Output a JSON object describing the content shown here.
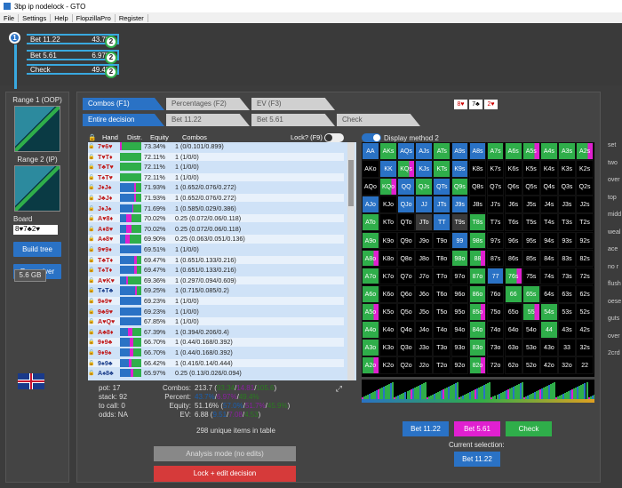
{
  "window": {
    "title": "3bp ip nodelock - GTO"
  },
  "menu": [
    "File",
    "Settings",
    "Help",
    "FlopzillaPro",
    "Register"
  ],
  "tree": {
    "root_label": "1",
    "child_label": "2",
    "nodes": [
      {
        "label": "Bet 11.22",
        "pct": "43.7%"
      },
      {
        "label": "Bet 5.61",
        "pct": "6.97%"
      },
      {
        "label": "Check",
        "pct": "49.4%"
      }
    ]
  },
  "left": {
    "range1": "Range 1 (OOP)",
    "range2": "Range 2 (IP)",
    "board_label": "Board",
    "board_value": "8♥7♣2♥",
    "build_tree": "Build tree",
    "run_solver": "Run solver",
    "memory": "5.6 GB"
  },
  "tabs_top": [
    "Combos (F1)",
    "Percentages (F2)",
    "EV (F3)"
  ],
  "tabs_second": [
    "Entire decision",
    "Bet 11.22",
    "Bet 5.61",
    "Check"
  ],
  "board_cards": [
    "8♥",
    "7♣",
    "2♥"
  ],
  "table": {
    "headers": [
      "Hand",
      "Distr.",
      "Equity",
      "Combos"
    ],
    "lock_label": "Lock? (F9)",
    "rows": [
      {
        "hand": "7♥6♥",
        "equity": "73.34%",
        "combos": "1 (0/0.101/0.899)",
        "g": 0.9,
        "p": 0.1
      },
      {
        "hand": "T♥T♦",
        "equity": "72.11%",
        "combos": "1 (1/0/0)",
        "g": 1.0,
        "p": 0
      },
      {
        "hand": "T♣T♥",
        "equity": "72.11%",
        "combos": "1 (1/0/0)",
        "g": 1.0,
        "p": 0
      },
      {
        "hand": "T♠T♥",
        "equity": "72.11%",
        "combos": "1 (1/0/0)",
        "g": 1.0,
        "p": 0
      },
      {
        "hand": "J♦J♠",
        "equity": "71.93%",
        "combos": "1 (0.652/0.076/0.272)",
        "g": 0.27,
        "p": 0.08
      },
      {
        "hand": "J♣J♦",
        "equity": "71.93%",
        "combos": "1 (0.652/0.076/0.272)",
        "g": 0.27,
        "p": 0.08
      },
      {
        "hand": "J♦J♠",
        "equity": "71.69%",
        "combos": "1 (0.585/0.029/0.386)",
        "g": 0.39,
        "p": 0.03
      },
      {
        "hand": "A♥8♦",
        "equity": "70.02%",
        "combos": "0.25 (0.072/0.06/0.118)",
        "g": 0.47,
        "p": 0.24
      },
      {
        "hand": "A♦8♥",
        "equity": "70.02%",
        "combos": "0.25 (0.072/0.06/0.118)",
        "g": 0.47,
        "p": 0.24
      },
      {
        "hand": "A♠8♥",
        "equity": "69.90%",
        "combos": "0.25 (0.063/0.051/0.136)",
        "g": 0.54,
        "p": 0.2
      },
      {
        "hand": "9♥9♦",
        "equity": "69.51%",
        "combos": "1 (1/0/0)",
        "g": 0,
        "p": 0
      },
      {
        "hand": "T♣T♦",
        "equity": "69.47%",
        "combos": "1 (0.651/0.133/0.216)",
        "g": 0.22,
        "p": 0.13
      },
      {
        "hand": "T♠T♦",
        "equity": "69.47%",
        "combos": "1 (0.651/0.133/0.216)",
        "g": 0.22,
        "p": 0.13
      },
      {
        "hand": "A♥K♥",
        "equity": "69.36%",
        "combos": "1 (0.297/0.094/0.609)",
        "g": 0.61,
        "p": 0.09
      },
      {
        "hand": "T♠T♣",
        "equity": "69.25%",
        "combos": "1 (0.715/0.085/0.2)",
        "g": 0.2,
        "p": 0.09
      },
      {
        "hand": "9♠9♥",
        "equity": "69.23%",
        "combos": "1 (1/0/0)",
        "g": 0,
        "p": 0
      },
      {
        "hand": "9♣9♥",
        "equity": "69.23%",
        "combos": "1 (1/0/0)",
        "g": 0,
        "p": 0
      },
      {
        "hand": "A♥Q♥",
        "equity": "67.85%",
        "combos": "1 (1/0/0)",
        "g": 0,
        "p": 0
      },
      {
        "hand": "A♣8♦",
        "equity": "67.39%",
        "combos": "1 (0.394/0.206/0.4)",
        "g": 0.4,
        "p": 0.21
      },
      {
        "hand": "9♦9♣",
        "equity": "66.70%",
        "combos": "1 (0.44/0.168/0.392)",
        "g": 0.39,
        "p": 0.17
      },
      {
        "hand": "9♦9♠",
        "equity": "66.70%",
        "combos": "1 (0.44/0.168/0.392)",
        "g": 0.39,
        "p": 0.17
      },
      {
        "hand": "9♠9♣",
        "equity": "66.42%",
        "combos": "1 (0.416/0.14/0.444)",
        "g": 0.44,
        "p": 0.14
      },
      {
        "hand": "A♠8♣",
        "equity": "65.97%",
        "combos": "0.25 (0.13/0.026/0.094)",
        "g": 0.38,
        "p": 0.1
      }
    ]
  },
  "stats": {
    "pot": "pot: 17",
    "stack": "stack: 92",
    "to_call": "to call: 0",
    "odds": "odds: NA",
    "combos_label": "Combos:",
    "combos_total": "213.7",
    "combos_parts": [
      "93.34",
      "14.81",
      "105.6"
    ],
    "percent_label": "Percent:",
    "percent_parts": [
      "43.7%",
      "6.97%",
      "49.4%"
    ],
    "equity_label": "Equity:",
    "equity_total": "51.16%",
    "equity_parts": [
      "57.0%",
      "51.7%",
      "45.9%"
    ],
    "ev_label": "EV:",
    "ev_total": "6.88",
    "ev_parts": [
      "9.51",
      "7.08",
      "4.53"
    ],
    "unique": "298 unique items in table"
  },
  "buttons": {
    "analysis": "Analysis mode (no edits)",
    "lock_edit": "Lock + edit decision",
    "bet_11": "Bet 11.22",
    "bet_5": "Bet 5.61",
    "check": "Check",
    "current_selection_label": "Current selection:",
    "current_selection": "Bet 11.22"
  },
  "display_method": "Display method 2",
  "grid": {
    "ranks": [
      "A",
      "K",
      "Q",
      "J",
      "T",
      "9",
      "8",
      "7",
      "6",
      "5",
      "4",
      "3",
      "2"
    ],
    "ip_labels": [
      "AA",
      "AKs",
      "AQs",
      "AJs",
      "ATs",
      "A9s",
      "A8s",
      "A7s",
      "A6s",
      "A5s",
      "A4s",
      "A3s",
      "A2s"
    ]
  },
  "right_labels": [
    "set",
    "two",
    "over",
    "top",
    "midd",
    "weal",
    "ace",
    "no r",
    "flush",
    "oese",
    "guts",
    "over",
    "2crd"
  ],
  "colors": {
    "blue": "#2a72c5",
    "green": "#2fae4a",
    "magenta": "#e020d0",
    "red": "#d63a3a"
  }
}
